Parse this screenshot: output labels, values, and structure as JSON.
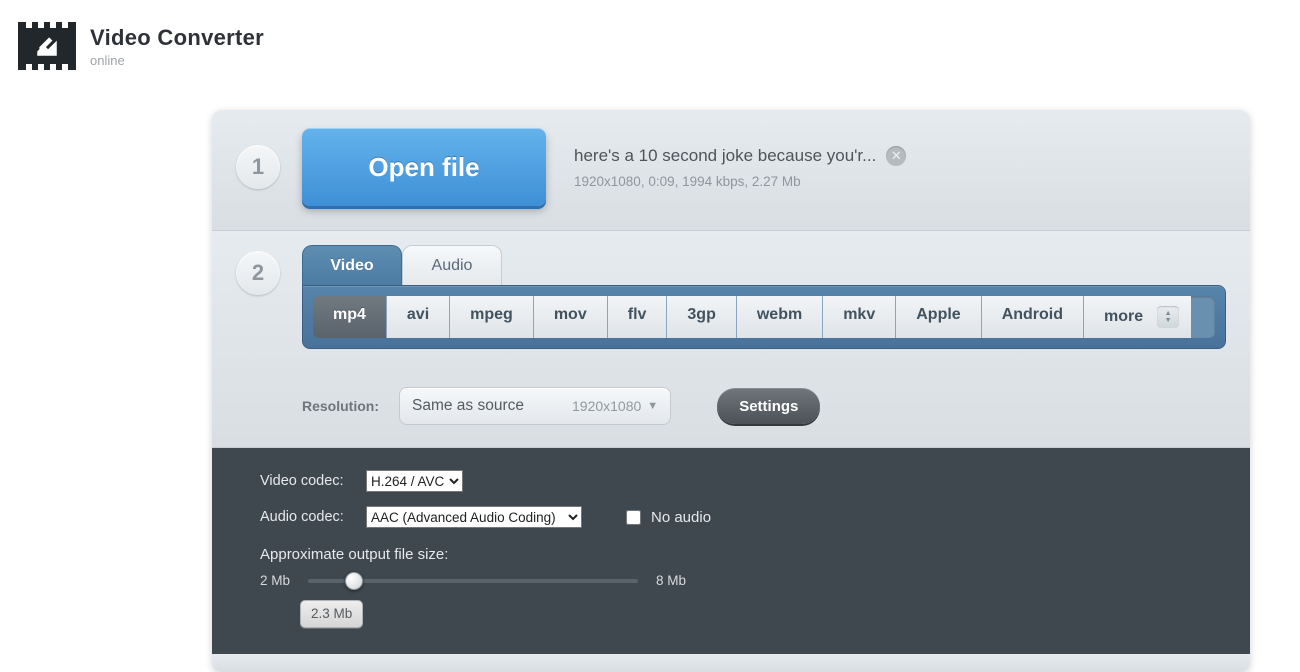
{
  "brand": {
    "title": "Video Converter",
    "subtitle": "online"
  },
  "step1": {
    "number": "1",
    "open_label": "Open file",
    "file_name": "here's a 10 second joke because you'r...",
    "file_meta": "1920x1080, 0:09, 1994 kbps, 2.27 Mb"
  },
  "step2": {
    "number": "2",
    "tabs": {
      "video": "Video",
      "audio": "Audio"
    },
    "formats": [
      "mp4",
      "avi",
      "mpeg",
      "mov",
      "flv",
      "3gp",
      "webm",
      "mkv",
      "Apple",
      "Android",
      "more"
    ],
    "resolution_label": "Resolution:",
    "resolution_main": "Same as source",
    "resolution_dim": "1920x1080",
    "settings_label": "Settings"
  },
  "advanced": {
    "video_codec_label": "Video codec:",
    "video_codec_value": "H.264 / AVC",
    "audio_codec_label": "Audio codec:",
    "audio_codec_value": "AAC (Advanced Audio Coding)",
    "no_audio_label": "No audio",
    "approx_label": "Approximate output file size:",
    "size_min": "2 Mb",
    "size_max": "8 Mb",
    "size_value": "2.3 Mb"
  }
}
